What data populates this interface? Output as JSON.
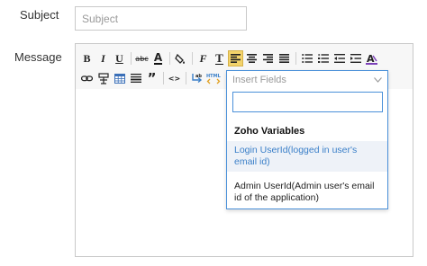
{
  "form": {
    "subject_label": "Subject",
    "subject_placeholder": "Subject",
    "subject_value": "",
    "message_label": "Message"
  },
  "toolbar": {
    "row1": [
      {
        "name": "bold-button",
        "glyph": "B",
        "icon": "bold-icon"
      },
      {
        "name": "italic-button",
        "glyph": "I",
        "icon": "italic-icon"
      },
      {
        "name": "underline-button",
        "glyph": "U",
        "icon": "underline-icon"
      },
      {
        "name": "strikethrough-button",
        "glyph": "abc",
        "icon": "strikethrough-icon"
      },
      {
        "name": "font-color-button",
        "glyph": "A",
        "icon": "font-color-icon"
      },
      {
        "name": "highlight-button",
        "glyph": "▲",
        "icon": "highlight-icon"
      },
      {
        "name": "font-family-button",
        "glyph": "F",
        "icon": "font-family-icon"
      },
      {
        "name": "font-size-button",
        "glyph": "T",
        "icon": "font-size-icon"
      },
      {
        "name": "align-left-button",
        "glyph": "≡",
        "icon": "align-left-icon"
      },
      {
        "name": "align-center-button",
        "glyph": "≡",
        "icon": "align-center-icon"
      },
      {
        "name": "align-right-button",
        "glyph": "≡",
        "icon": "align-right-icon"
      },
      {
        "name": "align-justify-button",
        "glyph": "≡",
        "icon": "align-justify-icon"
      },
      {
        "name": "bullet-list-button",
        "glyph": "☰",
        "icon": "bullet-list-icon"
      },
      {
        "name": "numbered-list-button",
        "glyph": "☰",
        "icon": "numbered-list-icon"
      },
      {
        "name": "outdent-button",
        "glyph": "⇤",
        "icon": "outdent-icon"
      },
      {
        "name": "indent-button",
        "glyph": "⇥",
        "icon": "indent-icon"
      },
      {
        "name": "clear-format-button",
        "glyph": "A",
        "icon": "clear-format-icon"
      }
    ],
    "row2": [
      {
        "name": "link-button",
        "glyph": "∞",
        "icon": "link-icon"
      },
      {
        "name": "image-button",
        "glyph": "✱",
        "icon": "image-icon"
      },
      {
        "name": "table-button",
        "glyph": "▦",
        "icon": "table-icon"
      },
      {
        "name": "horizontal-rule-button",
        "glyph": "☰",
        "icon": "horizontal-rule-icon"
      },
      {
        "name": "blockquote-button",
        "glyph": "”",
        "icon": "quote-icon"
      },
      {
        "name": "code-button",
        "glyph": "<>",
        "icon": "code-icon"
      },
      {
        "name": "insert-field-button",
        "glyph": "↳",
        "icon": "insert-field-icon"
      },
      {
        "name": "html-button",
        "glyph": "HTML",
        "icon": "html-icon"
      }
    ],
    "active_button": "align-left-button"
  },
  "insert_fields": {
    "header_label": "Insert Fields",
    "search_value": "",
    "group_label": "Zoho Variables",
    "options": [
      "Login UserId(logged in user's email id)",
      "Admin UserId(Admin user's email id of the application)"
    ],
    "highlighted_index": 0,
    "accent_color": "#4a90d9"
  }
}
